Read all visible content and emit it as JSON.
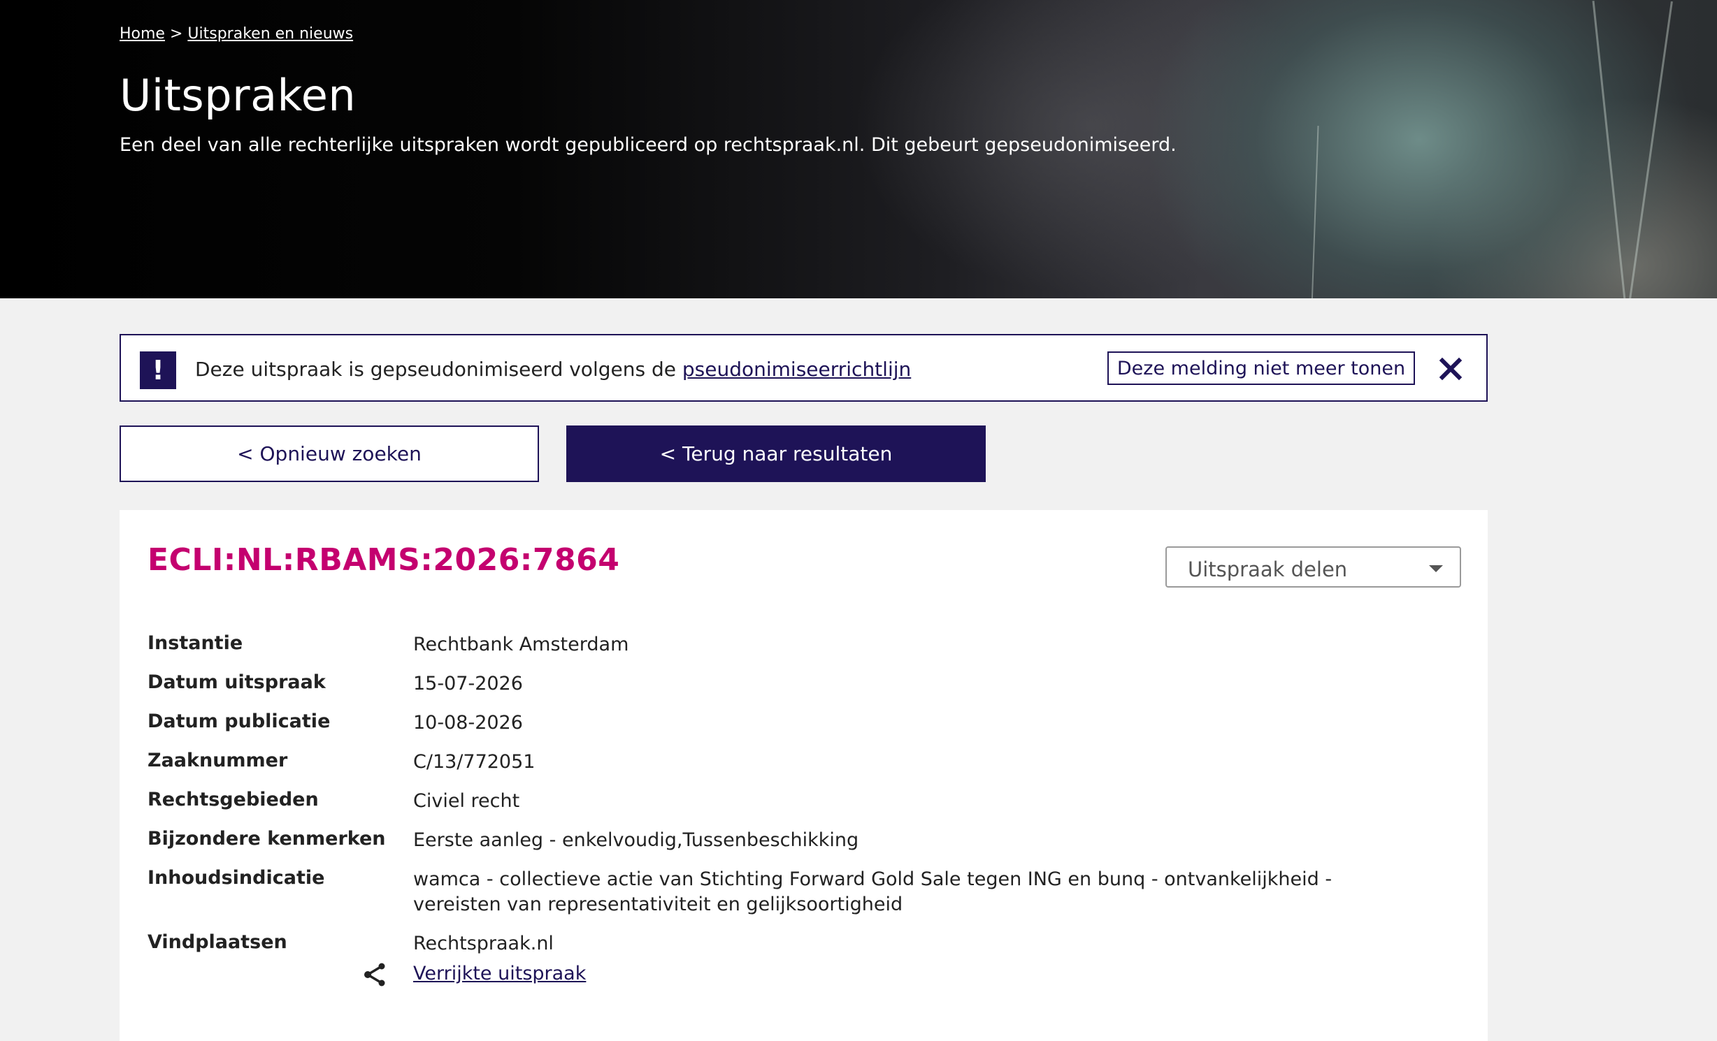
{
  "breadcrumb": {
    "home": "Home",
    "separator": ">",
    "current": "Uitspraken en nieuws"
  },
  "hero": {
    "title": "Uitspraken",
    "subtitle": "Een deel van alle rechterlijke uitspraken wordt gepubliceerd op rechtspraak.nl. Dit gebeurt gepseudonimiseerd."
  },
  "notice": {
    "icon": "exclamation-icon",
    "text": "Deze uitspraak is gepseudonimiseerd volgens de",
    "link": "pseudonimiseerrichtlijn",
    "dismiss_label": "Deze melding niet meer tonen",
    "close_icon": "close-icon"
  },
  "actions": {
    "search_again": "< Opnieuw zoeken",
    "back_to_results": "< Terug naar resultaten"
  },
  "ruling": {
    "ecli": "ECLI:NL:RBAMS:2026:7864",
    "share_label": "Uitspraak delen",
    "fields": [
      {
        "label": "Instantie",
        "value": "Rechtbank Amsterdam"
      },
      {
        "label": "Datum uitspraak",
        "value": "15-07-2026"
      },
      {
        "label": "Datum publicatie",
        "value": "10-08-2026"
      },
      {
        "label": "Zaaknummer",
        "value": "C/13/772051"
      },
      {
        "label": "Rechtsgebieden",
        "value": "Civiel recht"
      },
      {
        "label": "Bijzondere kenmerken",
        "value": "Eerste aanleg - enkelvoudig,Tussenbeschikking"
      },
      {
        "label": "Inhoudsindicatie",
        "value": "wamca - collectieve actie van Stichting Forward Gold Sale tegen ING en bunq - ontvankelijkheid - vereisten van representativiteit en gelijksoortigheid"
      },
      {
        "label": "Vindplaatsen",
        "value": "Rechtspraak.nl"
      }
    ],
    "enriched_link": "Verrijkte uitspraak",
    "enriched_icon": "share-nodes-icon"
  },
  "colors": {
    "brand": "#1e1357",
    "ecli": "#c4006f",
    "page_bg": "#f1f1f1"
  }
}
